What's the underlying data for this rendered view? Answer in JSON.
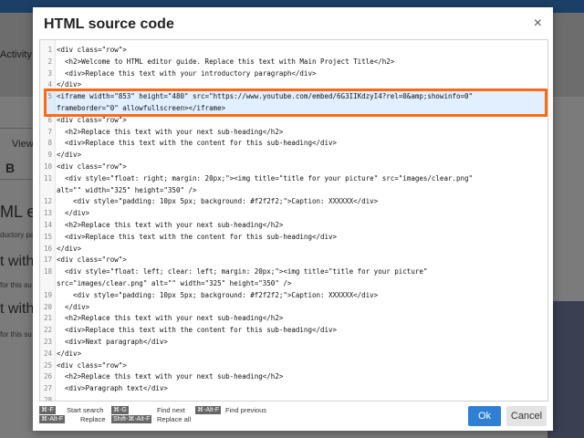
{
  "background": {
    "activity_label": "Activity",
    "view_label": "View",
    "bold_label": "B",
    "editor_title_fragment": "ML ed",
    "intro_fragment": "ductory para",
    "subheading_fragment_1": "t with",
    "this_fragment_1": "for this su",
    "subheading_fragment_2": "t with",
    "this_fragment_2": "for this su"
  },
  "dialog": {
    "title": "HTML source code",
    "close_icon": "×",
    "lines": [
      {
        "num": "1",
        "text": "<div class=\"row\">"
      },
      {
        "num": "2",
        "text": "  <h2>Welcome to HTML editor guide. Replace this text with Main Project Title</h2>"
      },
      {
        "num": "3",
        "text": "  <div>Replace this text with your introductory paragraph</div>"
      },
      {
        "num": "4",
        "text": "</div>"
      },
      {
        "num": "5",
        "text": "<iframe width=\"853\" height=\"480\" src=\"https://www.youtube.com/embed/6G3IIKdzyI4?rel=0&amp;showinfo=0\""
      },
      {
        "num": "",
        "text": "frameborder=\"0\" allowfullscreen></iframe>"
      },
      {
        "num": "6",
        "text": "<div class=\"row\">"
      },
      {
        "num": "7",
        "text": "  <h2>Replace this text with your next sub-heading</h2>"
      },
      {
        "num": "8",
        "text": "  <div>Replace this text with the content for this sub-heading</div>"
      },
      {
        "num": "9",
        "text": "</div>"
      },
      {
        "num": "10",
        "text": "<div class=\"row\">"
      },
      {
        "num": "11",
        "text": "  <div style=\"float: right; margin: 20px;\"><img title=\"title for your picture\" src=\"images/clear.png\""
      },
      {
        "num": "",
        "text": "alt=\"\" width=\"325\" height=\"350\" />"
      },
      {
        "num": "12",
        "text": "    <div style=\"padding: 10px 5px; background: #f2f2f2;\">Caption: XXXXXX</div>"
      },
      {
        "num": "13",
        "text": "  </div>"
      },
      {
        "num": "14",
        "text": "  <h2>Replace this text with your next sub-heading</h2>"
      },
      {
        "num": "15",
        "text": "  <div>Replace this text with the content for this sub-heading</div>"
      },
      {
        "num": "16",
        "text": "</div>"
      },
      {
        "num": "17",
        "text": "<div class=\"row\">"
      },
      {
        "num": "18",
        "text": "  <div style=\"float: left; clear: left; margin: 20px;\"><img title=\"title for your picture\""
      },
      {
        "num": "",
        "text": "src=\"images/clear.png\" alt=\"\" width=\"325\" height=\"350\" />"
      },
      {
        "num": "19",
        "text": "    <div style=\"padding: 10px 5px; background: #f2f2f2;\">Caption: XXXXXX</div>"
      },
      {
        "num": "20",
        "text": "  </div>"
      },
      {
        "num": "21",
        "text": "  <h2>Replace this text with your next sub-heading</h2>"
      },
      {
        "num": "22",
        "text": "  <div>Replace this text with the content for this sub-heading</div>"
      },
      {
        "num": "23",
        "text": "  <div>Next paragraph</div>"
      },
      {
        "num": "24",
        "text": "</div>"
      },
      {
        "num": "25",
        "text": "<div class=\"row\">"
      },
      {
        "num": "26",
        "text": "  <h2>Replace this text with your next sub-heading</h2>"
      },
      {
        "num": "27",
        "text": "  <div>Paragraph text</div>"
      },
      {
        "num": "28",
        "text": ""
      }
    ],
    "shortcuts": {
      "find_key": "⌘-F",
      "find_label": "Start search",
      "replace_key": "⌘-Alt-F",
      "replace_label": "Replace",
      "findnext_key": "⌘-G",
      "findnext_label": "Find next",
      "replaceall_key": "Shift-⌘-Alt-F",
      "replaceall_label": "Replace all",
      "findprev_key": "⌘-Alt-F",
      "findprev_label": "Find previous"
    },
    "ok_label": "Ok",
    "cancel_label": "Cancel"
  },
  "colors": {
    "highlight_border": "#ff6a13",
    "ok_button": "#2f7fd3"
  }
}
